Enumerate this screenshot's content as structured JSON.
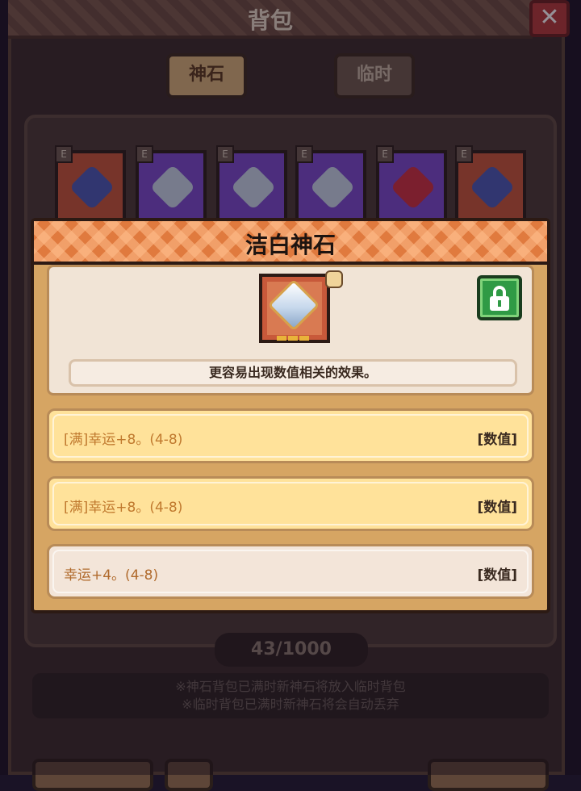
{
  "background": {
    "title": "背包",
    "close_label": "✕",
    "tabs": [
      {
        "label": "神石",
        "active": true
      },
      {
        "label": "临时",
        "active": false
      }
    ],
    "slots": [
      {
        "badge": "E",
        "frame_color": "#c8563a",
        "gem_color": "#4a5ab8"
      },
      {
        "badge": "E",
        "frame_color": "#7a4ad0",
        "gem_color": "#c8d8ec"
      },
      {
        "badge": "E",
        "frame_color": "#7a4ad0",
        "gem_color": "#c8d8ec"
      },
      {
        "badge": "E",
        "frame_color": "#7a4ad0",
        "gem_color": "#c8d8ec"
      },
      {
        "badge": "E",
        "frame_color": "#7a4ad0",
        "gem_color": "#d03040"
      },
      {
        "badge": "E",
        "frame_color": "#c8563a",
        "gem_color": "#4a5ab8"
      }
    ],
    "count": "43/1000",
    "notes": [
      "※神石背包已满时新神石将放入临时背包",
      "※临时背包已满时新神石将会自动丢弃"
    ]
  },
  "popup": {
    "title": "洁白神石",
    "gem_icon": "white-diamond-gem-icon",
    "locked": true,
    "description": "更容易出现数值相关的效果。",
    "effects": [
      {
        "text": "[满]幸运+8。(4-8)",
        "tag": "[数值]",
        "full": true
      },
      {
        "text": "[满]幸运+8。(4-8)",
        "tag": "[数值]",
        "full": true
      },
      {
        "text": "幸运+4。(4-8)",
        "tag": "[数值]",
        "full": false
      }
    ]
  },
  "colors": {
    "popup_header": "#e07a3e",
    "popup_body": "#d6a563",
    "effect_full_bg": "#ffe29a",
    "effect_partial_bg": "#f3e5d9",
    "effect_text": "#c0792e",
    "lock_green": "#2f9a45"
  }
}
